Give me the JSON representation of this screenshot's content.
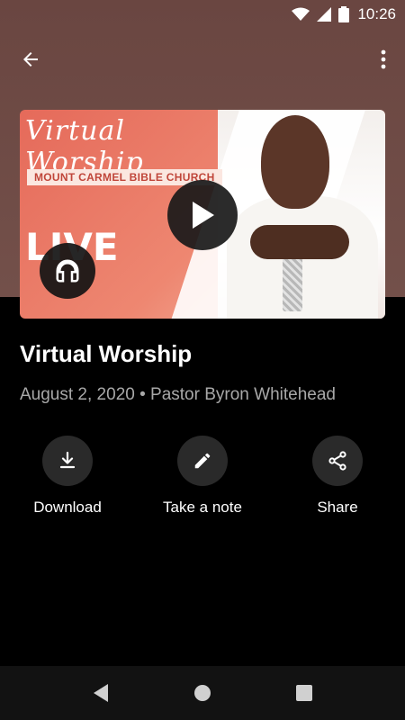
{
  "status_bar": {
    "time": "10:26"
  },
  "thumbnail": {
    "script_title": "Virtual Worship",
    "church_name": "MOUNT CARMEL BIBLE CHURCH",
    "live_label": "LIVE"
  },
  "episode": {
    "title": "Virtual Worship",
    "meta": "August 2, 2020 • Pastor Byron Whitehead"
  },
  "actions": [
    {
      "label": "Download",
      "icon": "download-icon"
    },
    {
      "label": "Take a note",
      "icon": "pencil-icon"
    },
    {
      "label": "Share",
      "icon": "share-icon"
    }
  ],
  "colors": {
    "header_bg": "#6a4641",
    "background": "#000000",
    "meta_text": "#a8a8a8",
    "action_circle": "#2a2a2a"
  }
}
